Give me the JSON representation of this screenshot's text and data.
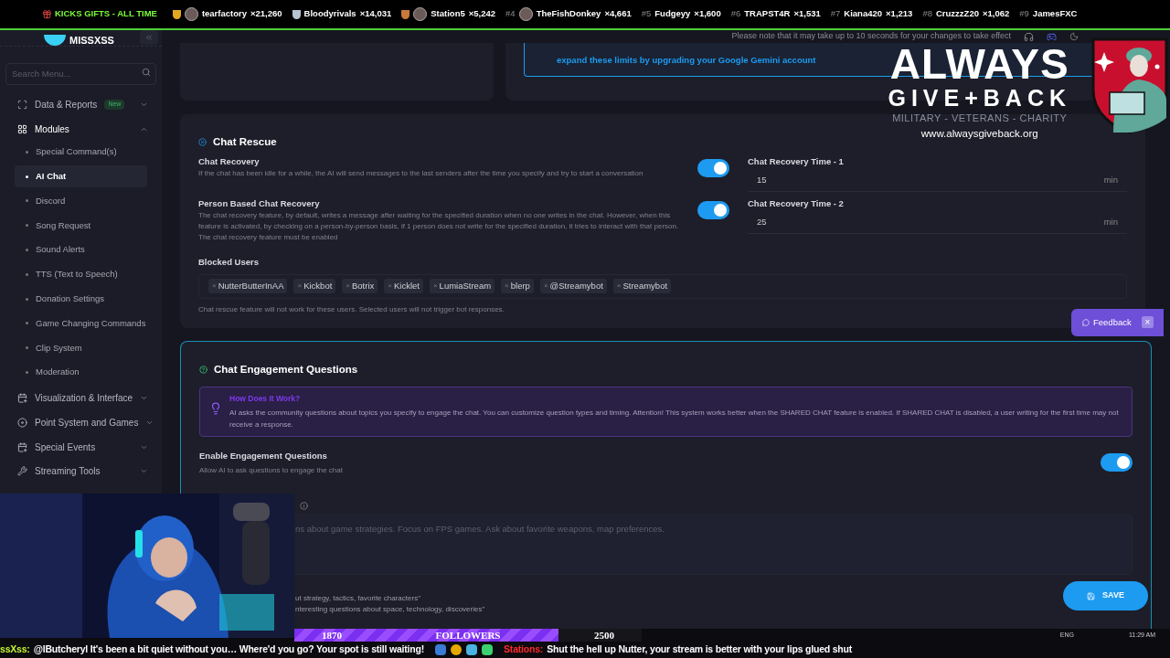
{
  "ticker": {
    "title": "KICKS GIFTS - ALL TIME",
    "entries": [
      {
        "kind": "medal",
        "color": "#e5a823",
        "avatar": true,
        "name": "tearfactory",
        "count": "×21,260"
      },
      {
        "kind": "medal",
        "color": "#b8c4d0",
        "avatar": false,
        "name": "Bloodyrivals",
        "count": "×14,031"
      },
      {
        "kind": "medal",
        "color": "#c77a3a",
        "avatar": true,
        "name": "Station5",
        "count": "×5,242"
      },
      {
        "kind": "ranked",
        "rank": "#4",
        "avatar": true,
        "name": "TheFishDonkey",
        "count": "×4,661"
      },
      {
        "kind": "ranked",
        "rank": "#5",
        "avatar": false,
        "name": "Fudgeyy",
        "count": "×1,600"
      },
      {
        "kind": "ranked",
        "rank": "#6",
        "avatar": false,
        "name": "TRAPST4R",
        "count": "×1,531"
      },
      {
        "kind": "ranked",
        "rank": "#7",
        "avatar": false,
        "name": "Kiana420",
        "count": "×1,213"
      },
      {
        "kind": "ranked",
        "rank": "#8",
        "avatar": false,
        "name": "CruzzzZ20",
        "count": "×1,062"
      },
      {
        "kind": "ranked",
        "rank": "#9",
        "avatar": false,
        "name": "JamesFXC"
      }
    ]
  },
  "sidebar": {
    "logo": "MISSXSS",
    "search": {
      "placeholder": "Search Menu..."
    },
    "items": [
      {
        "label": "Data & Reports",
        "badge": "New",
        "expanded": false
      },
      {
        "label": "Modules",
        "expanded": true,
        "children": [
          {
            "label": "Special Command(s)",
            "selected": false
          },
          {
            "label": "AI Chat",
            "selected": true
          },
          {
            "label": "Discord",
            "selected": false
          },
          {
            "label": "Song Request",
            "selected": false
          },
          {
            "label": "Sound Alerts",
            "selected": false
          },
          {
            "label": "TTS (Text to Speech)",
            "selected": false
          },
          {
            "label": "Donation Settings",
            "selected": false
          },
          {
            "label": "Game Changing Commands",
            "selected": false
          },
          {
            "label": "Clip System",
            "selected": false
          },
          {
            "label": "Moderation",
            "selected": false
          }
        ]
      },
      {
        "label": "Visualization & Interface",
        "expanded": false
      },
      {
        "label": "Point System and Games",
        "expanded": false
      },
      {
        "label": "Special Events",
        "expanded": false
      },
      {
        "label": "Streaming Tools",
        "expanded": false
      }
    ]
  },
  "notice": "Please note that it may take up to 10 seconds for your changes to take effect",
  "gemini_notice": "expand these limits by upgrading your Google Gemini account",
  "chat_rescue": {
    "title": "Chat Rescue",
    "settings": [
      {
        "label": "Chat Recovery",
        "description": "If the chat has been idle for a while, the AI will send messages to the last senders after the time you specify and try to start a conversation",
        "on": true,
        "time_label": "Chat Recovery Time - 1",
        "time_value": "15",
        "unit": "min"
      },
      {
        "label": "Person Based Chat Recovery",
        "description": "The chat recovery feature, by default, writes a message after waiting for the specified duration when no one writes in the chat. However, when this feature is activated, by checking on a person-by-person basis, if 1 person does not write for the specified duration, it tries to interact with that person. The chat recovery feature must be enabled",
        "on": true,
        "time_label": "Chat Recovery Time - 2",
        "time_value": "25",
        "unit": "min"
      }
    ],
    "blocked": {
      "label": "Blocked Users",
      "remove": "×",
      "tags": [
        "NutterButterInAA",
        "Kickbot",
        "Botrix",
        "Kicklet",
        "LumiaStream",
        "blerp",
        "@Streamybot",
        "Streamybot"
      ],
      "hint": "Chat rescue feature will not work for these users. Selected users will not trigger bot responses."
    }
  },
  "feedback": {
    "label": "Feedback",
    "close": "×"
  },
  "engagement": {
    "title": "Chat Engagement Questions",
    "info": {
      "title": "How Does It Work?",
      "text": "AI asks the community questions about topics you specify to engage the chat. You can customize question types and timing. Attention! This system works better when the SHARED CHAT feature is enabled. If SHARED CHAT is disabled, a user writing for the first time may not receive a response."
    },
    "enable": {
      "label": "Enable Engagement Questions",
      "description": "Allow AI to ask questions to engage the chat",
      "on": true
    },
    "topics_placeholder": "ns about game strategies. Focus on FPS games. Ask about favorite weapons, map preferences.",
    "examples": [
      "ut strategy, tactics, favorite characters\"",
      "nteresting questions about space, technology, discoveries\""
    ]
  },
  "save": "SAVE",
  "promo": {
    "line1": "ALWAYS",
    "line2": "GIVE+BACK",
    "tagline": "MILITARY - VETERANS - CHARITY",
    "url": "www.alwaysgiveback.org"
  },
  "followers": {
    "current": "1870",
    "label": "FOLLOWERS",
    "goal": "2500",
    "level": 0.76
  },
  "chat": [
    {
      "user": "ssXss:",
      "color": "#c6f432",
      "text": "@lButcheryl It's been a bit quiet without you… Where'd you go? Your spot is still waiting!"
    },
    {
      "user": "Stations:",
      "color": "#ff2a2a",
      "text": "Shut the hell up Nutter, your stream is better with your lips glued shut"
    }
  ],
  "tray": {
    "lang": "ENG",
    "time": "11:29 AM"
  }
}
